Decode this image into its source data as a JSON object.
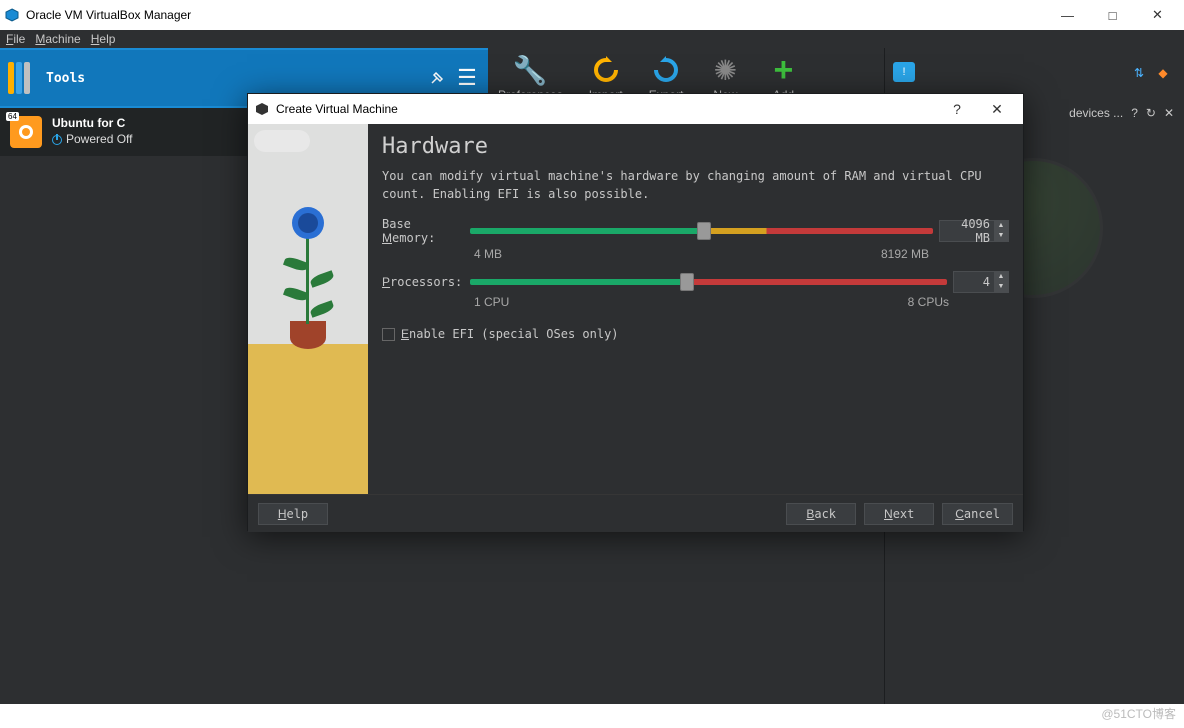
{
  "window": {
    "title": "Oracle VM VirtualBox Manager",
    "minimize": "—",
    "maximize": "□",
    "close": "✕"
  },
  "menu": {
    "file": "File",
    "machine": "Machine",
    "help": "Help"
  },
  "sidebar": {
    "tools": "Tools",
    "vm": {
      "name": "Ubuntu for C",
      "state": "Powered Off",
      "badge": "64"
    }
  },
  "toolbar": {
    "preferences": "Preferences",
    "import": "Import",
    "export": "Export",
    "new": "New",
    "add": "Add"
  },
  "right_panel": {
    "devices": "devices ..."
  },
  "dialog": {
    "title": "Create Virtual Machine",
    "help_q": "?",
    "close_x": "✕",
    "heading": "Hardware",
    "desc": "You can modify virtual machine's hardware by changing amount of RAM and virtual CPU count. Enabling EFI is also possible.",
    "memory": {
      "label": "Base Memory:",
      "value": "4096 MB",
      "min": "4 MB",
      "max": "8192 MB"
    },
    "processors": {
      "label": "Processors:",
      "value": "4",
      "min": "1 CPU",
      "max": "8 CPUs"
    },
    "efi_label": "Enable EFI (special OSes only)",
    "buttons": {
      "help": "Help",
      "back": "Back",
      "next": "Next",
      "cancel": "Cancel"
    }
  },
  "watermark": "@51CTO博客"
}
